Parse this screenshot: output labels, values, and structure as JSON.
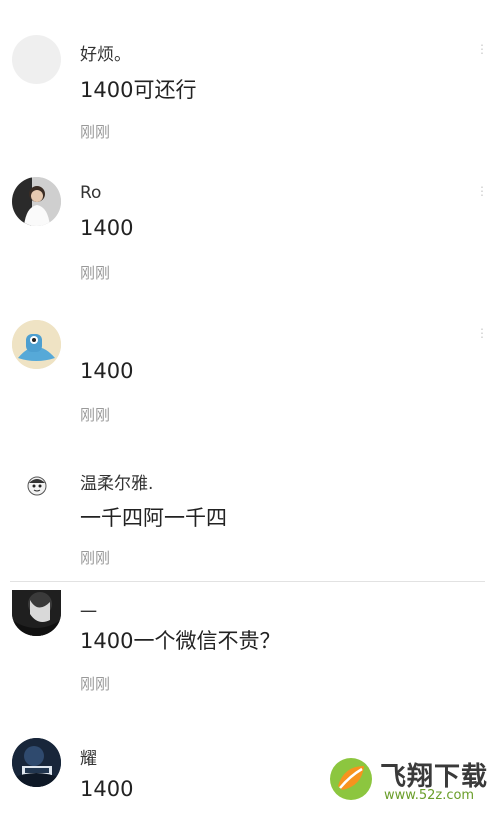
{
  "comments": [
    {
      "avatar": "blank-avatar",
      "name": "好烦。",
      "text": "1400可还行",
      "time": "刚刚"
    },
    {
      "avatar": "person-in-white-avatar",
      "name": "Ro",
      "text": "1400",
      "time": "刚刚"
    },
    {
      "avatar": "blue-cartoon-creature-avatar",
      "name": "",
      "text": "1400",
      "time": "刚刚"
    },
    {
      "avatar": "small-cartoon-face-avatar",
      "name": "温柔尔雅.",
      "text": "一千四阿一千四",
      "time": "刚刚"
    },
    {
      "avatar": "dark-portrait-avatar",
      "name": "一",
      "text": "1400一个微信不贵？",
      "time": "刚刚"
    },
    {
      "avatar": "dark-blue-photo-avatar",
      "name": "耀",
      "text": "1400",
      "time": ""
    }
  ],
  "watermark": {
    "title": "飞翔下载",
    "url": "www.52z.com",
    "logo_colors": [
      "#8cc63f",
      "#f7931e"
    ]
  }
}
